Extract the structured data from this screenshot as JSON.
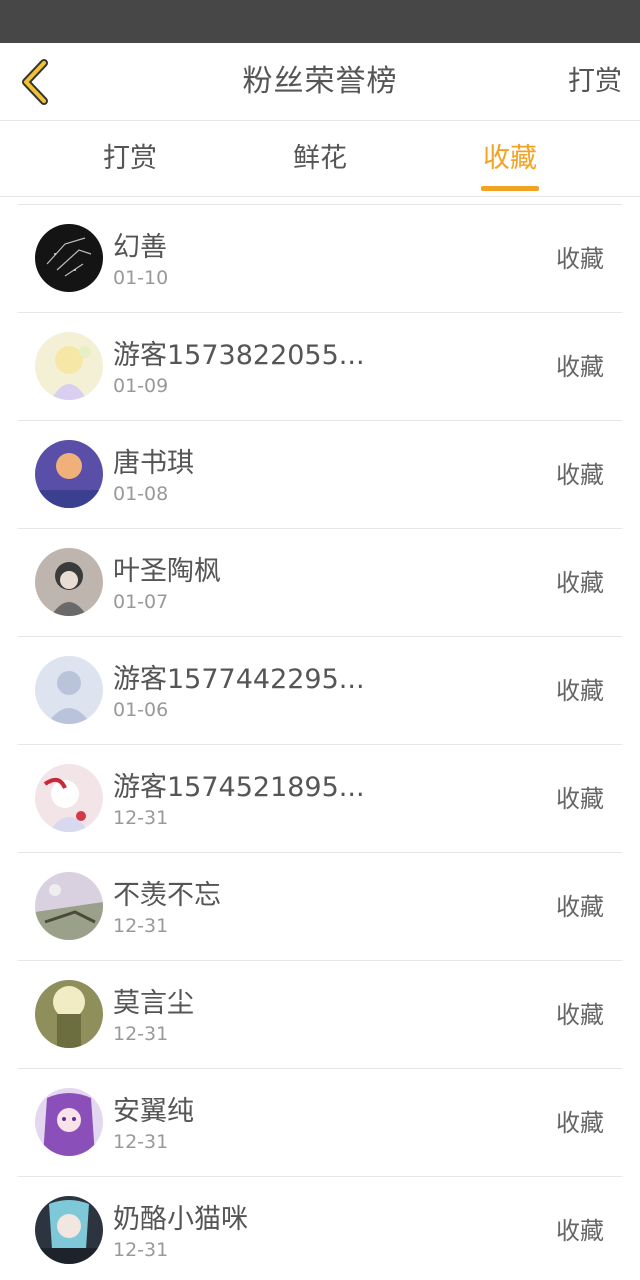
{
  "header": {
    "title": "粉丝荣誉榜",
    "action_label": "打赏"
  },
  "tabs": [
    {
      "label": "打赏"
    },
    {
      "label": "鲜花"
    },
    {
      "label": "收藏"
    }
  ],
  "active_tab_color": "#f2a324",
  "fans": [
    {
      "name": "幻善",
      "date": "01-10",
      "badge": "收藏"
    },
    {
      "name": "游客1573822055...",
      "date": "01-09",
      "badge": "收藏"
    },
    {
      "name": "唐书琪",
      "date": "01-08",
      "badge": "收藏"
    },
    {
      "name": "叶圣陶枫",
      "date": "01-07",
      "badge": "收藏"
    },
    {
      "name": "游客1577442295...",
      "date": "01-06",
      "badge": "收藏"
    },
    {
      "name": "游客1574521895...",
      "date": "12-31",
      "badge": "收藏"
    },
    {
      "name": "不羡不忘",
      "date": "12-31",
      "badge": "收藏"
    },
    {
      "name": "莫言尘",
      "date": "12-31",
      "badge": "收藏"
    },
    {
      "name": "安翼纯",
      "date": "12-31",
      "badge": "收藏"
    },
    {
      "name": "奶酪小猫咪",
      "date": "12-31",
      "badge": "收藏"
    }
  ]
}
